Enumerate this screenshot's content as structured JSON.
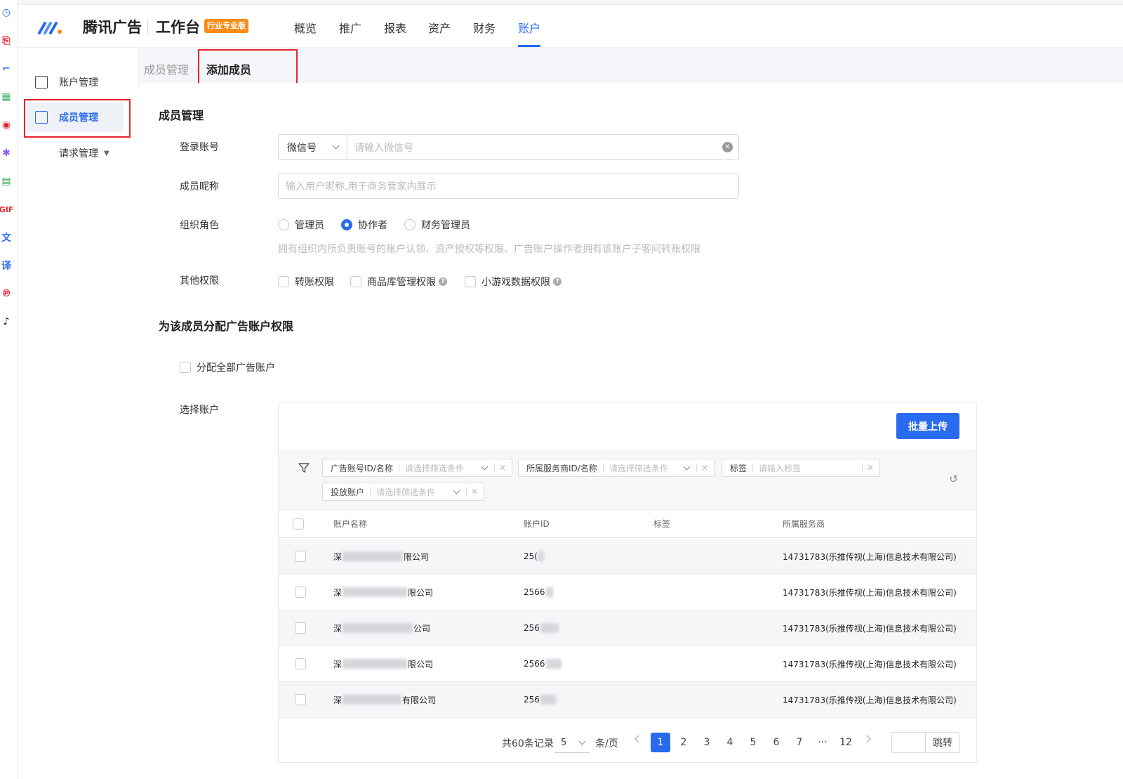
{
  "extension_icons": [
    {
      "name": "clock-extension-icon",
      "glyph": "◷",
      "color": "#296bef"
    },
    {
      "name": "pdf-extension-icon",
      "glyph": "⎘",
      "color": "#e8232e"
    },
    {
      "name": "crop-extension-icon",
      "glyph": "⌐",
      "color": "#296bef"
    },
    {
      "name": "qr-extension-icon",
      "glyph": "▦",
      "color": "#3cb371"
    },
    {
      "name": "record-extension-icon",
      "glyph": "◉",
      "color": "#e8232e"
    },
    {
      "name": "bug-extension-icon",
      "glyph": "✱",
      "color": "#8a5cf6"
    },
    {
      "name": "notes-extension-icon",
      "glyph": "▤",
      "color": "#2ea44f"
    },
    {
      "name": "gif-extension-icon",
      "glyph": "GIF",
      "color": "#e8232e"
    },
    {
      "name": "translate-extension-icon",
      "glyph": "文",
      "color": "#296bef"
    },
    {
      "name": "translate-select-extension-icon",
      "glyph": "译",
      "color": "#296bef"
    },
    {
      "name": "pinterest-extension-icon",
      "glyph": "℗",
      "color": "#e8232e"
    },
    {
      "name": "tiktok-extension-icon",
      "glyph": "♪",
      "color": "#111111"
    }
  ],
  "header": {
    "brand": "腾讯广告",
    "workbench": "工作台",
    "edition_badge": "行业专业版",
    "nav": [
      "概览",
      "推广",
      "报表",
      "资产",
      "财务",
      "账户"
    ],
    "active_nav": "账户"
  },
  "sidebar": {
    "items": [
      {
        "label": "账户管理",
        "icon": "id-card-icon"
      },
      {
        "label": "成员管理",
        "icon": "member-icon",
        "active": true
      },
      {
        "label": "请求管理",
        "icon": "caret-down-icon"
      }
    ]
  },
  "breadcrumb": {
    "parent": "成员管理",
    "separator": "›",
    "current": "添加成员"
  },
  "form": {
    "section_title": "成员管理",
    "login_label": "登录账号",
    "login_type": "微信号",
    "login_placeholder": "请输入微信号",
    "nickname_label": "成员昵称",
    "nickname_placeholder": "输入用户昵称,用于商务管家内展示",
    "role_label": "组织角色",
    "roles": [
      "管理员",
      "协作者",
      "财务管理员"
    ],
    "role_selected": "协作者",
    "role_helper": "拥有组织内所负责账号的账户认领、资产授权等权限、广告账户操作者拥有该账户子客间转账权限",
    "perm_label": "其他权限",
    "perms": [
      "转账权限",
      "商品库管理权限",
      "小游戏数据权限"
    ]
  },
  "assign": {
    "section_title": "为该成员分配广告账户权限",
    "assign_all": "分配全部广告账户",
    "select_label": "选择账户",
    "upload_button": "批量上传",
    "filters": [
      {
        "label": "广告账号ID/名称",
        "placeholder": "请选择筛选条件",
        "type": "select"
      },
      {
        "label": "所属服务商ID/名称",
        "placeholder": "请选择筛选条件",
        "type": "select"
      },
      {
        "label": "标签",
        "placeholder": "请输入标签",
        "type": "input"
      },
      {
        "label": "投放账户",
        "placeholder": "请选择筛选条件",
        "type": "select"
      }
    ],
    "columns": [
      "账户名称",
      "账户ID",
      "标签",
      "所属服务商"
    ],
    "rows": [
      {
        "name_prefix": "深",
        "name_suffix": "限公司",
        "id_prefix": "25(",
        "tag": "",
        "provider": "14731783(乐推传视(上海)信息技术有限公司)"
      },
      {
        "name_prefix": "深",
        "name_suffix": "限公司",
        "id_prefix": "2566",
        "tag": "",
        "provider": "14731783(乐推传视(上海)信息技术有限公司)"
      },
      {
        "name_prefix": "深",
        "name_suffix": "公司",
        "id_prefix": "256",
        "tag": "",
        "provider": "14731783(乐推传视(上海)信息技术有限公司)"
      },
      {
        "name_prefix": "深",
        "name_suffix": "限公司",
        "id_prefix": "2566",
        "tag": "",
        "provider": "14731783(乐推传视(上海)信息技术有限公司)"
      },
      {
        "name_prefix": "深",
        "name_suffix": "有限公司",
        "id_prefix": "256",
        "tag": "",
        "provider": "14731783(乐推传视(上海)信息技术有限公司)"
      }
    ],
    "pagination": {
      "total_text": "共60条记录",
      "page_size": "5",
      "per_page_text": "条/页",
      "pages": [
        "1",
        "2",
        "3",
        "4",
        "5",
        "6",
        "7",
        "···",
        "12"
      ],
      "current": "1",
      "jump_label": "跳转"
    }
  },
  "colors": {
    "primary": "#296bef",
    "highlight_box": "#e8232e",
    "badge": "#fa8c16"
  }
}
